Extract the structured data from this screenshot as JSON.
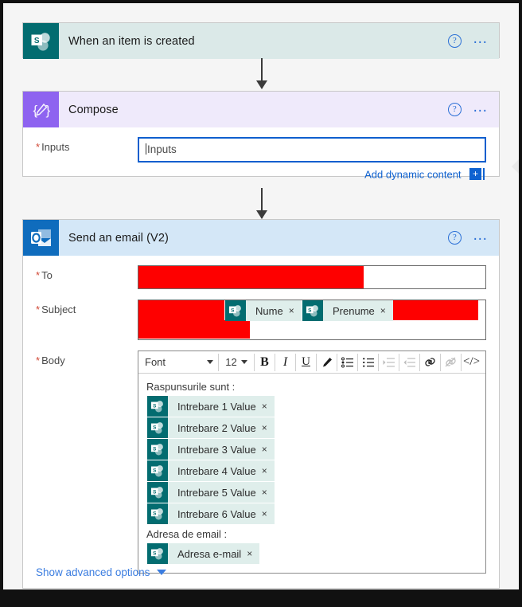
{
  "steps": {
    "trigger": {
      "title": "When an item is created",
      "icon": "sharepoint-icon",
      "help_icon": "help-icon",
      "more_icon": "more-options-icon",
      "header_color": "#dbe9e8"
    },
    "compose": {
      "title": "Compose",
      "icon": "compose-icon",
      "header_color": "#efeafb",
      "inputs_label": "Inputs",
      "inputs_placeholder": "Inputs",
      "add_dynamic_content": "Add dynamic content",
      "plus_label": "+"
    },
    "send_email": {
      "title": "Send an email (V2)",
      "icon": "outlook-icon",
      "header_color": "#d4e7f7",
      "to_label": "To",
      "subject_label": "Subject",
      "body_label": "Body",
      "subject_tokens": [
        {
          "label": "Nume",
          "close": "×"
        },
        {
          "label": "Prenume",
          "close": "×"
        }
      ],
      "toolbar": {
        "font_label": "Font",
        "size_label": "12",
        "bold": "B",
        "italic": "I",
        "underline": "U",
        "text_color": "✎",
        "bullet_list": "☰",
        "number_list": "☰",
        "indent": "→",
        "outdent": "←",
        "link": "⚭",
        "unlink": "⚭",
        "code": "</>"
      },
      "body_line_1": "Raspunsurile sunt :",
      "body_tokens": [
        {
          "label": "Intrebare 1 Value",
          "close": "×"
        },
        {
          "label": "Intrebare 2 Value",
          "close": "×"
        },
        {
          "label": "Intrebare 3 Value",
          "close": "×"
        },
        {
          "label": "Intrebare 4 Value",
          "close": "×"
        },
        {
          "label": "Intrebare 5 Value",
          "close": "×"
        },
        {
          "label": "Intrebare 6 Value",
          "close": "×"
        }
      ],
      "body_line_2": "Adresa de email :",
      "email_token": {
        "label": "Adresa e-mail",
        "close": "×"
      },
      "show_advanced_options": "Show advanced options"
    }
  },
  "colors": {
    "sharepoint_teal": "#036c70",
    "outlook_blue": "#0f6cbd",
    "compose_purple": "#8e63f0",
    "link_blue": "#0f62d0",
    "redaction_red": "#fe0000",
    "required_red": "#d14836"
  }
}
